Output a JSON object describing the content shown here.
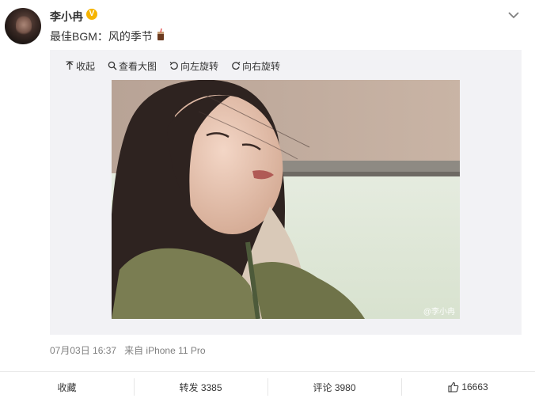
{
  "post": {
    "author": "李小冉",
    "verified_badge": "V",
    "text": "最佳BGM：风的季节",
    "emoji_icon": "drink-icon"
  },
  "media_toolbar": {
    "collapse": "收起",
    "view_large": "查看大图",
    "rotate_left": "向左旋转",
    "rotate_right": "向右旋转"
  },
  "photo": {
    "watermark": "@李小冉"
  },
  "meta": {
    "date": "07月03日 16:37",
    "source": "来自 iPhone 11 Pro"
  },
  "actions": {
    "favorite": "收藏",
    "repost": "转发 3385",
    "comment": "评论 3980",
    "like_count": "16663"
  },
  "colors": {
    "badge": "#f6b400",
    "media_background": "#f2f2f5",
    "meta_text": "#808080"
  }
}
